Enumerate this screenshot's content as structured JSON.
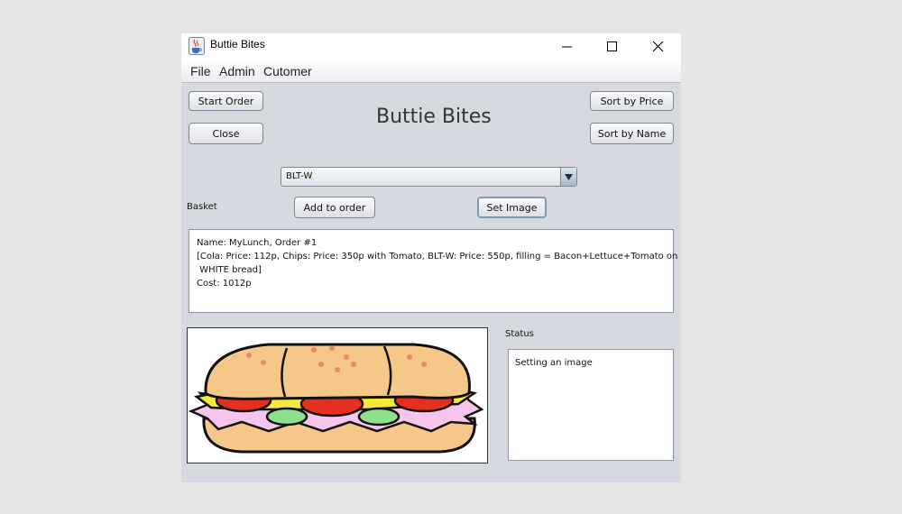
{
  "window": {
    "title": "Buttie Bites",
    "app_icon": "java-cup-icon"
  },
  "menu": [
    "File",
    "Admin",
    "Cutomer"
  ],
  "buttons": {
    "start_order": "Start Order",
    "close": "Close",
    "sort_price": "Sort by Price",
    "sort_name": "Sort by Name",
    "add_to_order": "Add to order",
    "set_image": "Set Image"
  },
  "heading": "Buttie Bites",
  "product_select": {
    "selected": "BLT-W"
  },
  "basket": {
    "label": "Basket",
    "lines": [
      "Name: MyLunch, Order #1",
      "[Cola: Price: 112p, Chips: Price: 350p with Tomato, BLT-W: Price: 550p, filling = Bacon+Lettuce+Tomato on",
      " WHITE bread]",
      "Cost: 1012p"
    ]
  },
  "status": {
    "label": "Status",
    "text": "Setting an image"
  },
  "image": {
    "icon": "sandwich-image"
  },
  "colors": {
    "window_bg": "#d6d9df",
    "focus_border": "#7b9bbd"
  }
}
